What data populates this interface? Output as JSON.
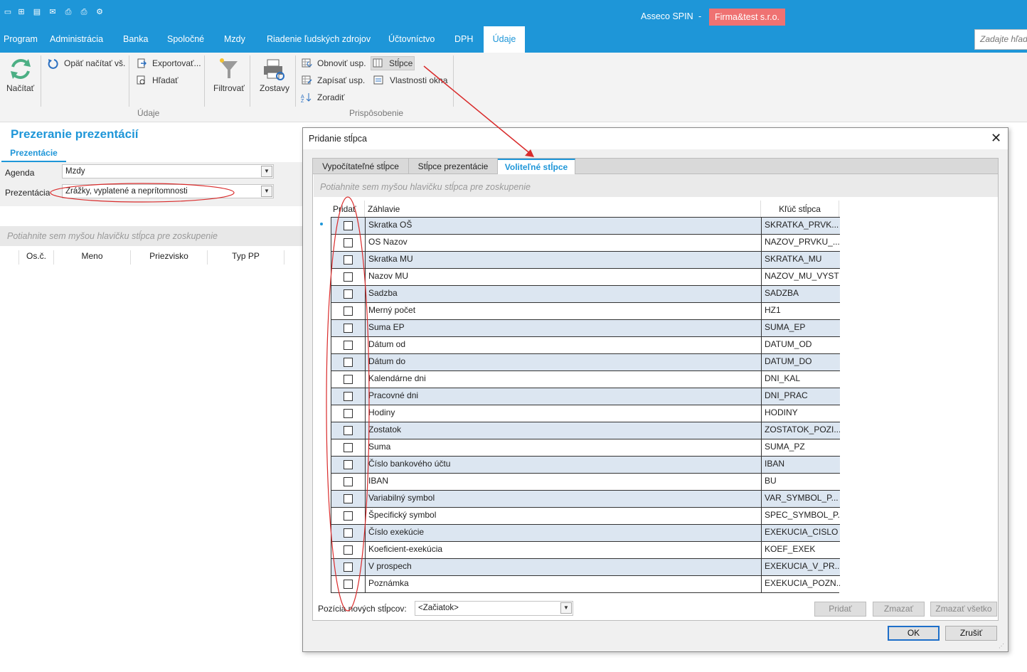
{
  "app": {
    "title": "Asseco SPIN",
    "separator": "-",
    "company": "Firma&test s.r.o.",
    "search_placeholder": "Zadajte hľad"
  },
  "menu": [
    "Program",
    "Administrácia",
    "Banka",
    "Spoločné",
    "Mzdy",
    "Riadenie ľudských zdrojov",
    "Účtovníctvo",
    "DPH",
    "Údaje"
  ],
  "ribbon": {
    "nacitat": "Načítať",
    "opat": "Opäť načítať vš.",
    "export": "Exportovať...",
    "hladat": "Hľadať",
    "filtrovat": "Filtrovať",
    "zostavy": "Zostavy",
    "obnovit": "Obnoviť usp.",
    "zapisat": "Zapísať usp.",
    "zoradit": "Zoradiť",
    "stlpce": "Stĺpce",
    "vlastnosti": "Vlastnosti okna",
    "group_udaje": "Údaje",
    "group_prisp": "Prispôsobenie"
  },
  "left": {
    "title": "Prezeranie prezentácií",
    "tab": "Prezentácie",
    "agenda_label": "Agenda",
    "agenda_value": "Mzdy",
    "prez_label": "Prezentácia",
    "prez_value": "Zrážky, vyplatené a neprítomnosti",
    "group_hint": "Potiahnite sem myšou hlavičku stĺpca pre zoskupenie",
    "columns": [
      "Os.č.",
      "Meno",
      "Priezvisko",
      "Typ PP"
    ]
  },
  "dialog": {
    "title": "Pridanie stĺpca",
    "tabs": [
      "Vypočítateľné stĺpce",
      "Stĺpce prezentácie",
      "Voliteľné stĺpce"
    ],
    "group_hint": "Potiahnite sem myšou hlavičku stĺpca pre zoskupenie",
    "grid_headers": {
      "add": "Pridať",
      "title": "Záhlavie",
      "key": "Kľúč stĺpca"
    },
    "rows": [
      {
        "title": "Skratka OŠ",
        "key": "SKRATKA_PRVK..."
      },
      {
        "title": "OS Nazov",
        "key": "NAZOV_PRVKU_..."
      },
      {
        "title": "Skratka MU",
        "key": "SKRATKA_MU"
      },
      {
        "title": "Nazov MU",
        "key": "NAZOV_MU_VYST"
      },
      {
        "title": "Sadzba",
        "key": "SADZBA"
      },
      {
        "title": "Merný počet",
        "key": "HZ1"
      },
      {
        "title": "Suma EP",
        "key": "SUMA_EP"
      },
      {
        "title": "Dátum od",
        "key": "DATUM_OD"
      },
      {
        "title": "Dátum do",
        "key": "DATUM_DO"
      },
      {
        "title": "Kalendárne dni",
        "key": "DNI_KAL"
      },
      {
        "title": "Pracovné dni",
        "key": "DNI_PRAC"
      },
      {
        "title": "Hodiny",
        "key": "HODINY"
      },
      {
        "title": "Zostatok",
        "key": "ZOSTATOK_POZI..."
      },
      {
        "title": "Suma",
        "key": "SUMA_PZ"
      },
      {
        "title": "Číslo bankového účtu",
        "key": "IBAN"
      },
      {
        "title": "IBAN",
        "key": "BU"
      },
      {
        "title": "Variabilný symbol",
        "key": "VAR_SYMBOL_P..."
      },
      {
        "title": "Špecifický symbol",
        "key": "SPEC_SYMBOL_P..."
      },
      {
        "title": "Číslo exekúcie",
        "key": "EXEKUCIA_CISLO"
      },
      {
        "title": "Koeficient-exekúcia",
        "key": "KOEF_EXEK"
      },
      {
        "title": "V prospech",
        "key": "EXEKUCIA_V_PR..."
      },
      {
        "title": "Poznámka",
        "key": "EXEKUCIA_POZN..."
      }
    ],
    "pos_label": "Pozícia nových stĺpcov:",
    "pos_value": "<Začiatok>",
    "btn_pridat": "Pridať",
    "btn_zmazat": "Zmazať",
    "btn_zmazat_vsetko": "Zmazať všetko",
    "btn_ok": "OK",
    "btn_zrusit": "Zrušiť"
  },
  "colors": {
    "accent": "#1e96d8",
    "badge": "#ef7272",
    "row_alt": "#dce6f1",
    "annotation": "#d92b2b"
  }
}
